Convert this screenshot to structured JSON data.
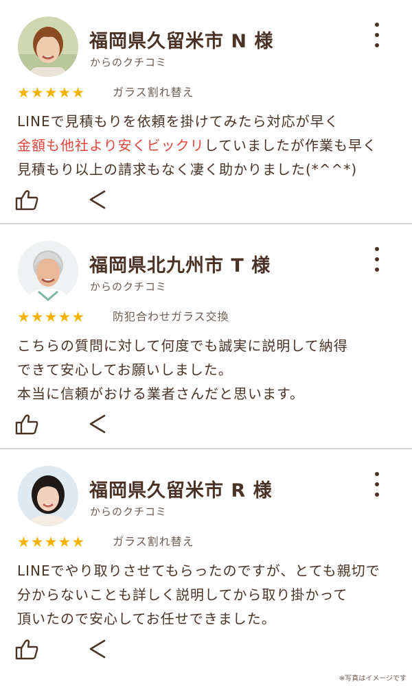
{
  "colors": {
    "text": "#4a3226",
    "star": "#f2b400",
    "highlight": "#e0463c",
    "divider": "#d6d6d6"
  },
  "reviews": [
    {
      "name": "福岡県久留米市 N 様",
      "source": "からのクチコミ",
      "rating": 5,
      "stars": "★★★★★",
      "service": "ガラス割れ替え",
      "lines": {
        "l1": "LINEで見積もりを依頼を掛けてみたら対応が早く",
        "l2_highlight": "金額も他社より安くビックリ",
        "l2_rest": "していましたが作業も早く",
        "l3": "見積もり以上の請求もなく凄く助かりました(*^^*)"
      }
    },
    {
      "name": "福岡県北九州市 T 様",
      "source": "からのクチコミ",
      "rating": 5,
      "stars": "★★★★★",
      "service": "防犯合わせガラス交換",
      "lines": {
        "l1": "こちらの質問に対して何度でも誠実に説明して納得",
        "l2": "できて安心してお願いしました。",
        "l3": "本当に信頼がおける業者さんだと思います。"
      }
    },
    {
      "name": "福岡県久留米市 R 様",
      "source": "からのクチコミ",
      "rating": 5,
      "stars": "★★★★★",
      "service": "ガラス割れ替え",
      "lines": {
        "l1": " LINEでやり取りさせてもらったのですが、とても親切で",
        "l2": "分からないことも詳しく説明してから取り掛かって",
        "l3": "頂いたので安心してお任せできました。"
      }
    }
  ],
  "footer_note": "※写真はイメージです",
  "icons": {
    "like": "thumbs-up-icon",
    "share": "share-icon",
    "menu": "more-vertical-icon"
  }
}
